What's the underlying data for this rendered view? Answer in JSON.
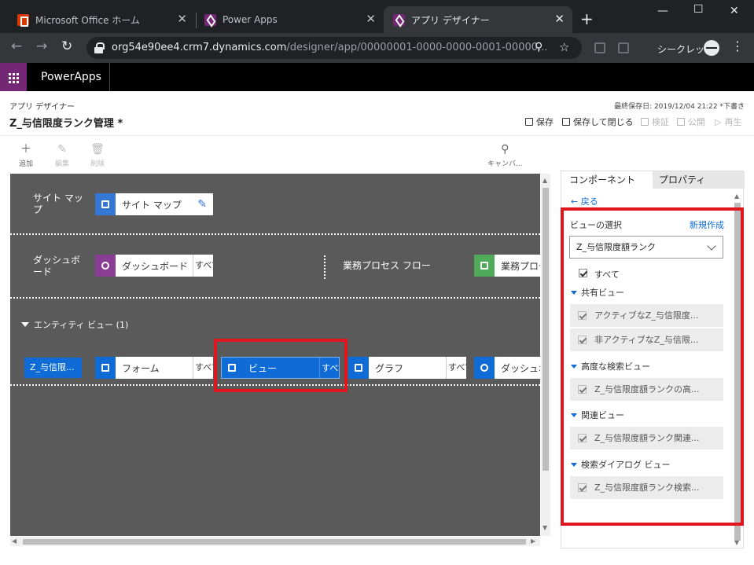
{
  "browser": {
    "tabs": [
      {
        "title": "Microsoft Office ホーム",
        "favicon": "office-icon"
      },
      {
        "title": "Power Apps",
        "favicon": "powerapps-icon"
      },
      {
        "title": "アプリ デザイナー",
        "favicon": "powerapps-icon",
        "active": true
      }
    ],
    "url_host": "org54e90ee4.crm7.dynamics.com",
    "url_path": "/designer/app/00000001-0000-0000-0001-00000...",
    "incognito_label": "シークレット"
  },
  "header": {
    "product": "PowerApps"
  },
  "designer": {
    "caption": "アプリ デザイナー",
    "app_name": "Z_与信限度ランク管理 *",
    "last_saved": "最終保存日: 2019/12/04 21:22 *下書き",
    "commands": {
      "save": "保存",
      "save_close": "保存して閉じる",
      "validate": "検証",
      "publish": "公開",
      "play": "再生"
    }
  },
  "toolbar": {
    "add": "追加",
    "edit": "編集",
    "delete": "削除",
    "canvas": "キャンバ..."
  },
  "canvas": {
    "sitemap_label": "サイト マップ",
    "sitemap_card": "サイト マップ",
    "dashboard_label": "ダッシュボード",
    "dashboard_card": "ダッシュボード",
    "all_short": "すべて",
    "bpf_label": "業務プロセス フロー",
    "bpf_card": "業務プロセ",
    "entity_view_header": "エンティティ ビュー (1)",
    "entity_name": "Z_与信限...",
    "form_card": "フォーム",
    "view_card": "ビュー",
    "view_all": "すべて",
    "chart_card": "グラフ",
    "dashboard2_card": "ダッシュボ"
  },
  "panel": {
    "tab_components": "コンポーネント",
    "tab_properties": "プロパティ",
    "back": "戻る",
    "view_select_label": "ビューの選択",
    "new_link": "新規作成",
    "selected_entity": "Z_与信限度額ランク",
    "all_label": "すべて",
    "groups": [
      {
        "title": "共有ビュー",
        "items": [
          "アクティブなZ_与信限度...",
          "非アクティブなZ_与信限..."
        ]
      },
      {
        "title": "高度な検索ビュー",
        "items": [
          "Z_与信限度額ランクの高..."
        ]
      },
      {
        "title": "関連ビュー",
        "items": [
          "Z_与信限度額ランク関連..."
        ]
      },
      {
        "title": "検索ダイアログ ビュー",
        "items": [
          "Z_与信限度額ランク検索..."
        ]
      }
    ]
  },
  "colors": {
    "accent": "#0f6cd6",
    "powerapps_purple": "#742774",
    "highlight_red": "#e0151e",
    "canvas_bg": "#5a5a5a"
  }
}
